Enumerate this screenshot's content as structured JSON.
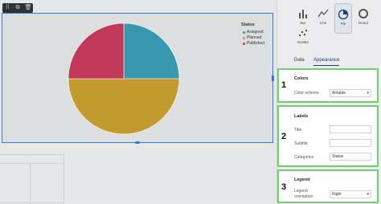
{
  "toolbar": {
    "icons": [
      "drag-icon",
      "duplicate-icon",
      "trash-icon"
    ]
  },
  "legend": {
    "title": "Status",
    "items": [
      {
        "label": "Assigned",
        "color": "#3a97b0"
      },
      {
        "label": "Planned",
        "color": "#c39a2e"
      },
      {
        "label": "Published",
        "color": "#c0395a"
      }
    ]
  },
  "chart_data": {
    "type": "pie",
    "title": "",
    "categories": [
      "Assigned",
      "Planned",
      "Published"
    ],
    "values": [
      25,
      50,
      25
    ],
    "colors": [
      "#3a97b0",
      "#c39a2e",
      "#c0395a"
    ],
    "legend_placement": "top-right",
    "legend_title": "Status"
  },
  "chart_types": [
    {
      "label": "Bar",
      "icon": "bar-chart-icon",
      "active": false
    },
    {
      "label": "Line",
      "icon": "line-chart-icon",
      "active": false
    },
    {
      "label": "Pie",
      "icon": "pie-chart-icon",
      "active": true
    },
    {
      "label": "Donut",
      "icon": "donut-chart-icon",
      "active": false
    },
    {
      "label": "Scatter",
      "icon": "scatter-chart-icon",
      "active": false
    }
  ],
  "tabs": [
    {
      "label": "Data",
      "active": false
    },
    {
      "label": "Appearance",
      "active": true
    }
  ],
  "sections": {
    "colors": {
      "number": "1",
      "title": "Colors",
      "scheme_label": "Color scheme",
      "scheme_value": "Airtable"
    },
    "labels": {
      "number": "2",
      "title": "Labels",
      "title_label": "Title",
      "title_value": "",
      "subtitle_label": "Subtitle",
      "subtitle_value": "",
      "categories_label": "Categories",
      "categories_value": "Status"
    },
    "legend": {
      "number": "3",
      "title": "Legend",
      "orientation_label": "Legend orientation",
      "orientation_value": "Right"
    }
  }
}
